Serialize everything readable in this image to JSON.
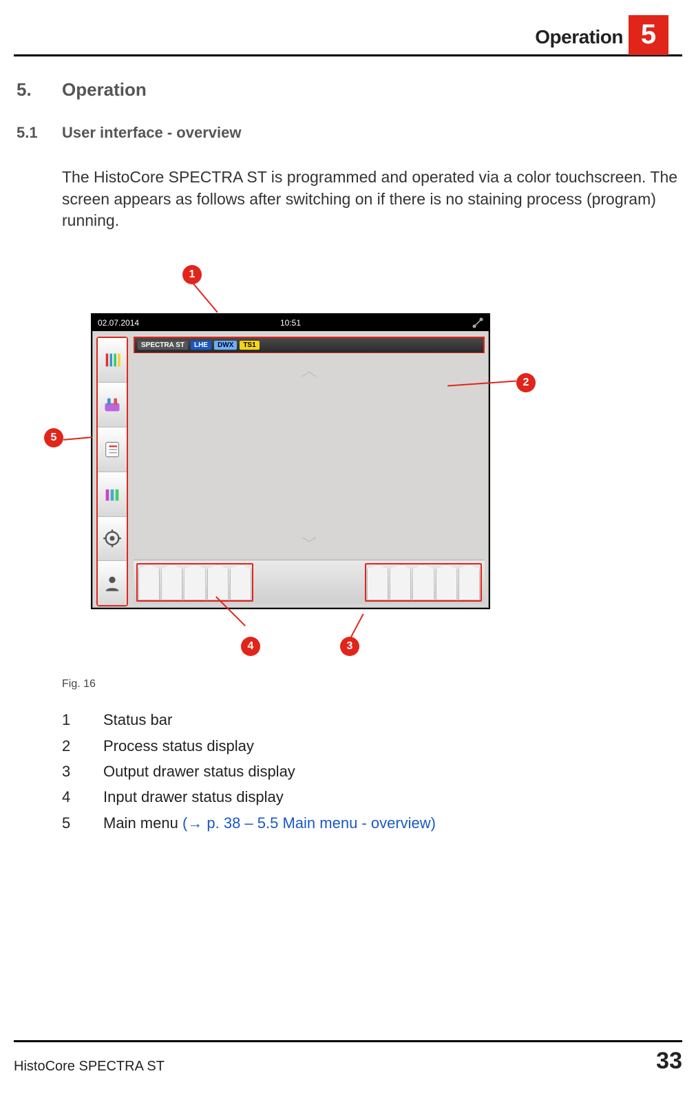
{
  "header": {
    "chapter_title": "Operation",
    "chapter_number": "5"
  },
  "section": {
    "number": "5.",
    "title": "Operation"
  },
  "subsection": {
    "number": "5.1",
    "title": "User interface - overview"
  },
  "paragraph": "The HistoCore SPECTRA ST is programmed and operated via a color touchscreen. The screen appears as follows after switching on if there is no staining process (program) running.",
  "figure": {
    "caption": "Fig. 16",
    "callouts": {
      "c1": "1",
      "c2": "2",
      "c3": "3",
      "c4": "4",
      "c5": "5"
    },
    "screen": {
      "date": "02.07.2014",
      "time": "10:51",
      "status_tags": {
        "spectra": "SPECTRA ST",
        "lhe": "LHE",
        "dwx": "DWX",
        "ts1": "TS1"
      }
    }
  },
  "legend": {
    "items": [
      {
        "n": "1",
        "text": "Status bar"
      },
      {
        "n": "2",
        "text": "Process status display"
      },
      {
        "n": "3",
        "text": "Output drawer status display"
      },
      {
        "n": "4",
        "text": "Input drawer status display"
      },
      {
        "n": "5",
        "text": "Main menu ",
        "xref": "(→ p. 38 – 5.5 Main menu - overview)"
      }
    ]
  },
  "footer": {
    "product": "HistoCore SPECTRA ST",
    "page": "33"
  }
}
